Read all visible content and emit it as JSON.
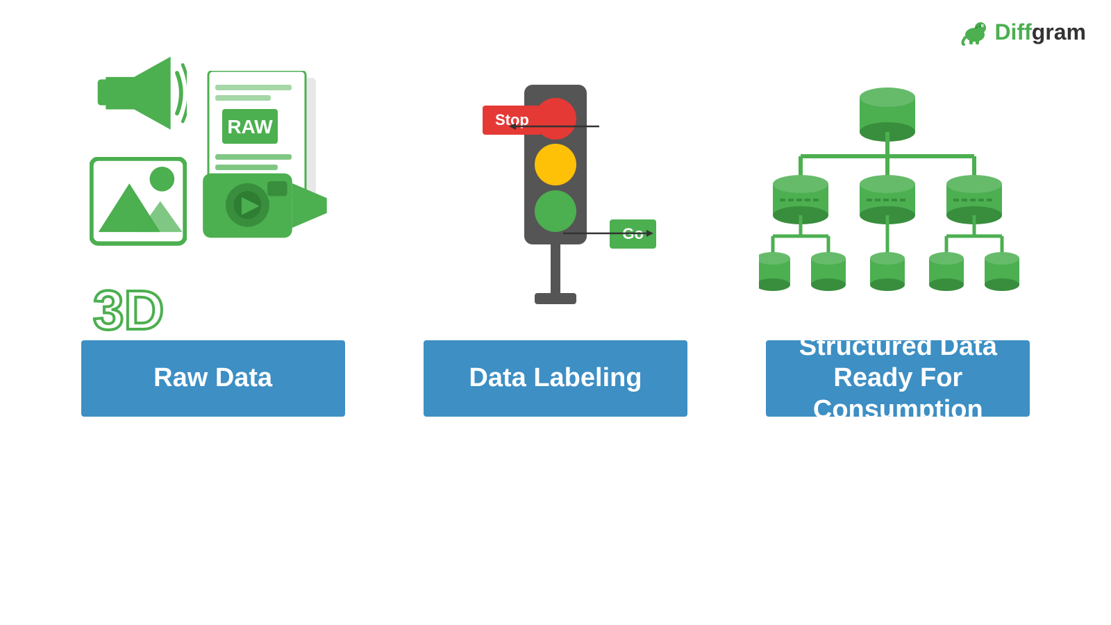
{
  "logo": {
    "brand": "Diffgram",
    "brand_green": "Diff",
    "brand_dark": "gram"
  },
  "columns": [
    {
      "id": "raw-data",
      "label": "Raw Data"
    },
    {
      "id": "data-labeling",
      "label": "Data Labeling"
    },
    {
      "id": "structured-data",
      "label": "Structured Data Ready For Consumption"
    }
  ],
  "traffic_light": {
    "stop_label": "Stop",
    "go_label": "Go"
  },
  "colors": {
    "green": "#4CAF50",
    "blue_label": "#3d8fc4",
    "red": "#e53935",
    "yellow": "#FFC107",
    "dark": "#555555"
  }
}
